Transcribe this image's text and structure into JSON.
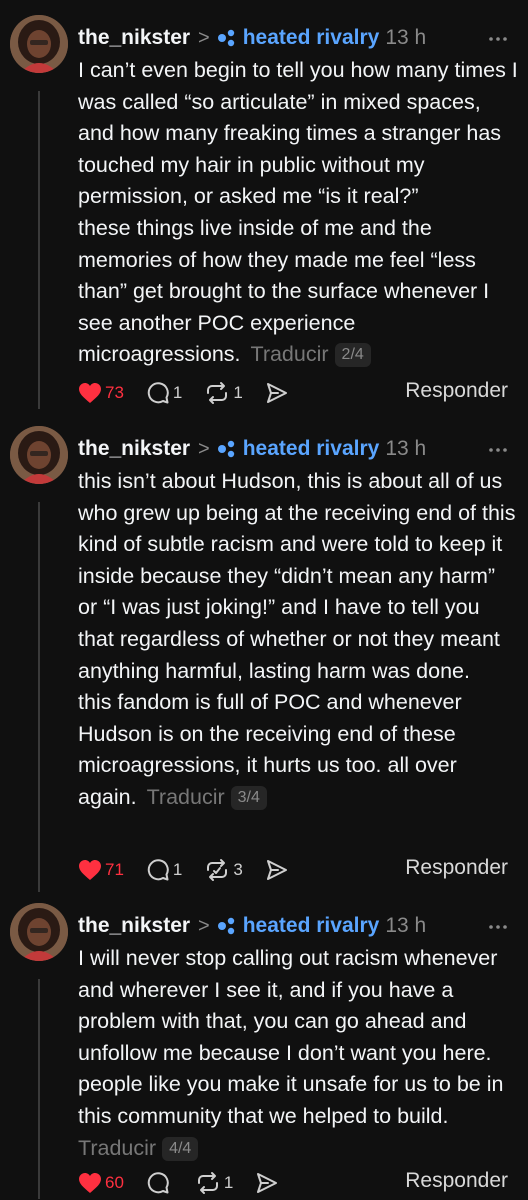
{
  "posts": [
    {
      "username": "the_nikster",
      "community": "heated rivalry",
      "time": "13 h",
      "paragraphs": [
        "I can’t even begin to tell you how many times I was called “so articulate” in mixed spaces, and how many freaking times a stranger has touched my hair in public without my permission, or asked me “is it real?”",
        "these things live inside of me and the memories of how they made me feel “less than” get brought to the surface whenever I see another POC experience microagressions."
      ],
      "translate": "Traducir",
      "pager": "2/4",
      "likes": "73",
      "comments": "1",
      "reposts": "1",
      "reply": "Responder"
    },
    {
      "username": "the_nikster",
      "community": "heated rivalry",
      "time": "13 h",
      "paragraphs": [
        "this isn’t about Hudson, this is about all of us who grew up being at the receiving end of this kind of subtle racism and were told to keep it inside because they “didn’t mean any harm” or “I was just joking!” and I have to tell you that regardless of whether or not they meant anything harmful, lasting harm was done.",
        "this fandom is full of POC and whenever Hudson is on the receiving end of these microagressions, it hurts us too. all over again."
      ],
      "translate": "Traducir",
      "pager": "3/4",
      "likes": "71",
      "comments": "1",
      "reposts": "3",
      "reply": "Responder"
    },
    {
      "username": "the_nikster",
      "community": "heated rivalry",
      "time": "13 h",
      "paragraphs": [
        "I will never stop calling out racism whenever and wherever I see it, and if you have a problem with that, you can go ahead and unfollow me because I don’t want you here. people like you make it unsafe for us to be in this community that we helped to build."
      ],
      "translate": "Traducir",
      "pager": "4/4",
      "likes": "60",
      "comments": "",
      "reposts": "1",
      "reply": "Responder"
    }
  ],
  "colors": {
    "background": "#101010",
    "text": "#f3f5f7",
    "community": "#5aa5ff",
    "like": "#ff3040",
    "muted": "#8a8a8a"
  },
  "icons": [
    "heart-icon",
    "comment-icon",
    "repost-icon",
    "share-icon",
    "more-icon",
    "community-icon",
    "chevron-right-icon"
  ]
}
